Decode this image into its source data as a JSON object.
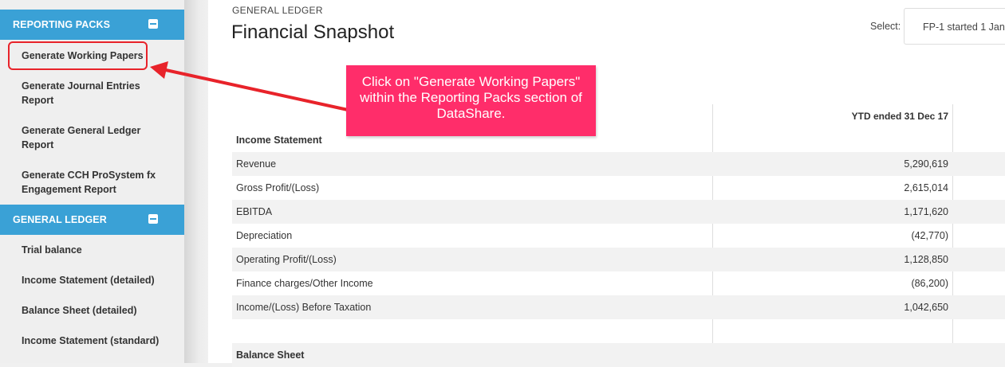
{
  "sidebar": {
    "sections": [
      {
        "title": "REPORTING PACKS",
        "items": [
          "Generate Working Papers",
          "Generate Journal Entries Report",
          "Generate General Ledger Report",
          "Generate CCH ProSystem fx Engagement Report"
        ]
      },
      {
        "title": "GENERAL LEDGER",
        "items": [
          "Trial balance",
          "Income Statement (detailed)",
          "Balance Sheet (detailed)",
          "Income Statement (standard)"
        ]
      }
    ]
  },
  "header": {
    "eyebrow": "GENERAL LEDGER",
    "title": "Financial Snapshot",
    "select_label": "Select:",
    "select_value": "FP-1 started 1 Jan"
  },
  "table": {
    "column_header": "YTD ended 31 Dec 17",
    "rows": [
      {
        "label": "Income Statement",
        "value": ""
      },
      {
        "label": "Revenue",
        "value": "5,290,619"
      },
      {
        "label": "Gross Profit/(Loss)",
        "value": "2,615,014"
      },
      {
        "label": "EBITDA",
        "value": "1,171,620"
      },
      {
        "label": "Depreciation",
        "value": "(42,770)"
      },
      {
        "label": "Operating Profit/(Loss)",
        "value": "1,128,850"
      },
      {
        "label": "Finance charges/Other Income",
        "value": "(86,200)"
      },
      {
        "label": "Income/(Loss) Before Taxation",
        "value": "1,042,650"
      },
      {
        "label": "",
        "value": ""
      },
      {
        "label": "Balance Sheet",
        "value": ""
      }
    ]
  },
  "callout": {
    "text": "Click on \"Generate Working Papers\" within the Reporting Packs section of DataShare."
  },
  "colors": {
    "section_header": "#3aa1d6",
    "callout": "#ff2d6a",
    "highlight": "#e8232a"
  }
}
